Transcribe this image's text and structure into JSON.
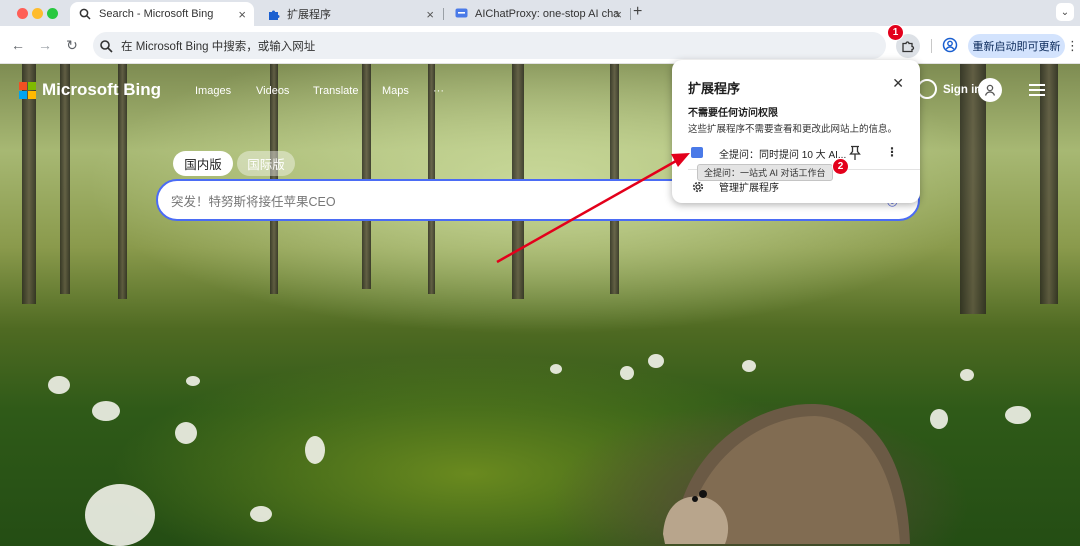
{
  "browser": {
    "tabs": [
      {
        "title": "Search - Microsoft Bing",
        "active": true,
        "icon": "search-icon"
      },
      {
        "title": "扩展程序",
        "active": false,
        "icon": "puzzle-icon"
      },
      {
        "title": "AIChatProxy: one-stop AI cha",
        "active": false,
        "icon": "chat-icon"
      }
    ],
    "new_tab": "+",
    "omnibox_text": "在 Microsoft Bing 中搜索，或输入网址",
    "relaunch_label": "重新启动即可更新",
    "badges": {
      "one": "1",
      "two": "2"
    }
  },
  "bing": {
    "logo_text": "Microsoft Bing",
    "nav": [
      "Images",
      "Videos",
      "Translate",
      "Maps",
      "···"
    ],
    "sign_in": "Sign in",
    "region_tabs": [
      "国内版",
      "国际版"
    ],
    "search_placeholder": "突发！特努斯将接任苹果CEO"
  },
  "extensions_popup": {
    "title": "扩展程序",
    "section_heading": "不需要任何访问权限",
    "section_desc": "这些扩展程序不需要查看和更改此网站上的信息。",
    "extension_name": "全提问：同时提问 10 大 AI...",
    "tooltip": "全提问：一站式 AI 对话工作台",
    "manage_label": "管理扩展程序"
  },
  "colors": {
    "accent": "#4b6cf5",
    "badge": "#e3001b",
    "relaunch_bg": "#d3e3fd",
    "annotation_arrow": "#e3001b"
  }
}
